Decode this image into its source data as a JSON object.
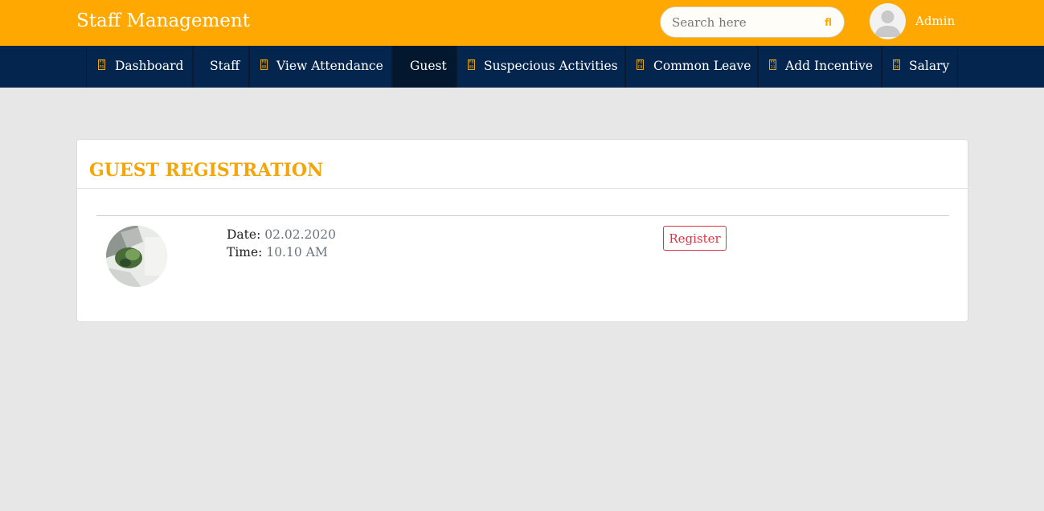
{
  "header": {
    "brand": "Staff Management",
    "search_placeholder": "Search here",
    "search_icon": "fl",
    "user_name": "Admin",
    "colors": {
      "topbar": "#ffa801",
      "navbar": "#04264e",
      "accent": "#f4a50a"
    }
  },
  "nav": {
    "items": [
      {
        "label": "Dashboard",
        "icon_name": "dashboard-icon",
        "glyph": "F3 FD"
      },
      {
        "label": "Staff",
        "icon_name": "",
        "glyph": ""
      },
      {
        "label": "View Attendance",
        "icon_name": "attendance-icon",
        "glyph": "F0 0R"
      },
      {
        "label": "Guest",
        "icon_name": "",
        "glyph": "",
        "active": true
      },
      {
        "label": "Suspecious Activities",
        "icon_name": "activities-icon",
        "glyph": "F0 0D"
      },
      {
        "label": "Common Leave",
        "icon_name": "leave-icon",
        "glyph": "F0 C8"
      },
      {
        "label": "Add Incentive",
        "icon_name": "incentive-icon",
        "glyph": "F5 11"
      },
      {
        "label": "Salary",
        "icon_name": "salary-icon",
        "glyph": "F0 D6"
      }
    ]
  },
  "main": {
    "title": "GUEST REGISTRATION",
    "guest": {
      "date_label": "Date:",
      "date_value": "02.02.2020",
      "time_label": "Time:",
      "time_value": "10.10 AM",
      "register_label": "Register"
    }
  }
}
